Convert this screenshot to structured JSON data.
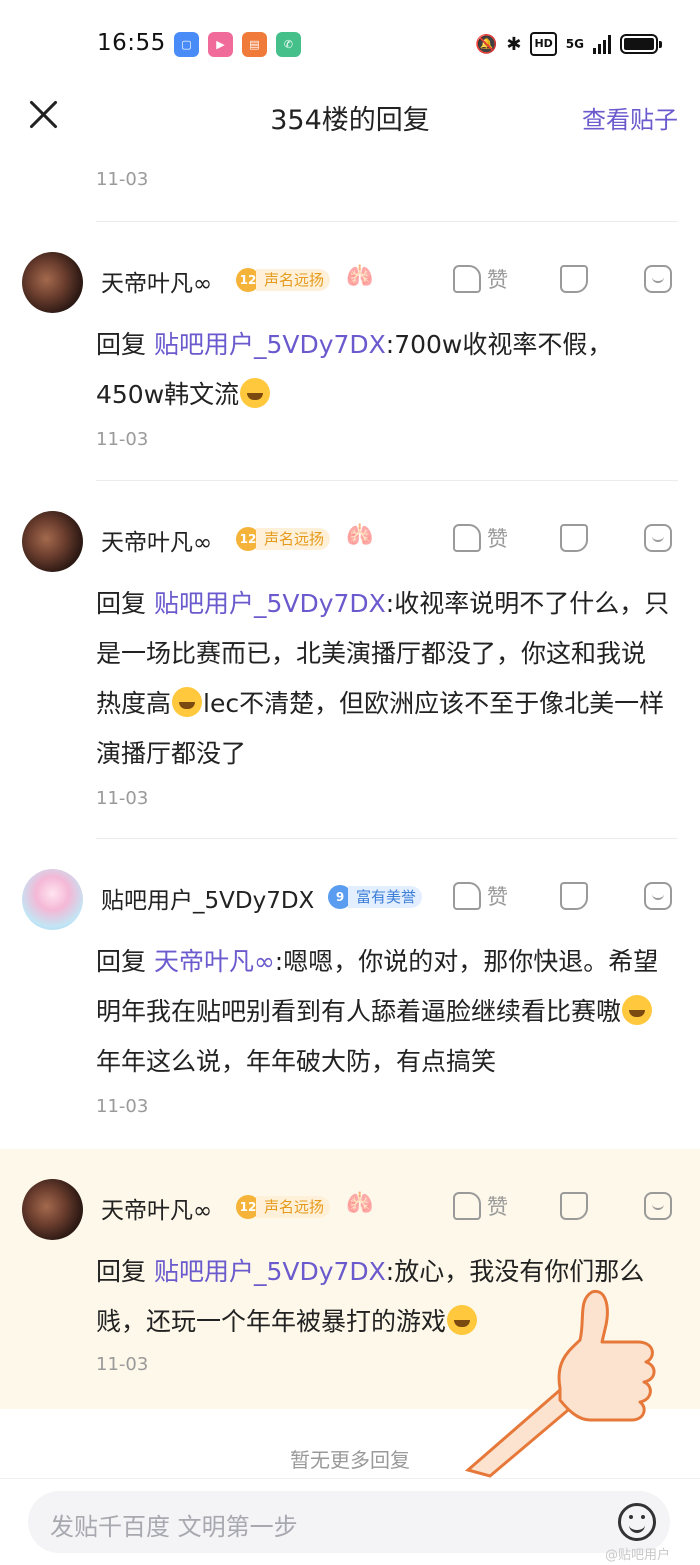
{
  "status_bar": {
    "time": "16:55",
    "apps": [
      {
        "name": "app-blue",
        "color": "#4a8cf7"
      },
      {
        "name": "bilibili",
        "color": "#f06a9a"
      },
      {
        "name": "reader",
        "color": "#f07a3a"
      },
      {
        "name": "phone",
        "color": "#45c08a"
      }
    ],
    "network": "5G",
    "hd_label": "HD"
  },
  "header": {
    "title": "354楼的回复",
    "view_post": "查看贴子"
  },
  "top_date": "11-03",
  "like_label": "赞",
  "reply_prefix": "回复 ",
  "replies": [
    {
      "username": "天帝叶凡∞",
      "level": "12",
      "level_title": "声名远扬",
      "mention": "贴吧用户_5VDy7DX",
      "text": ":700w收视率不假，450w韩文流",
      "date": "11-03"
    },
    {
      "username": "天帝叶凡∞",
      "level": "12",
      "level_title": "声名远扬",
      "mention": "贴吧用户_5VDy7DX",
      "text_a": ":收视率说明不了什么，只是一场比赛而已，北美演播厅都没了，你这和我说热度高",
      "text_b": "lec不清楚，但欧洲应该不至于像北美一样演播厅都没了",
      "date": "11-03"
    },
    {
      "username": "贴吧用户_5VDy7DX",
      "level": "9",
      "level_title": "富有美誉",
      "mention": "天帝叶凡∞",
      "text_a": ":嗯嗯，你说的对，那你快退。希望明年我在贴吧别看到有人舔着逼脸继续看比赛嗷",
      "text_b": " 年年这么说，年年破大防，有点搞笑",
      "date": "11-03"
    },
    {
      "username": "天帝叶凡∞",
      "level": "12",
      "level_title": "声名远扬",
      "mention": "贴吧用户_5VDy7DX",
      "text": ":放心，我没有你们那么贱，还玩一个年年被暴打的游戏",
      "date": "11-03"
    }
  ],
  "no_more": "暂无更多回复",
  "input": {
    "placeholder": "发贴千百度 文明第一步"
  },
  "watermark": "@贴吧用户"
}
